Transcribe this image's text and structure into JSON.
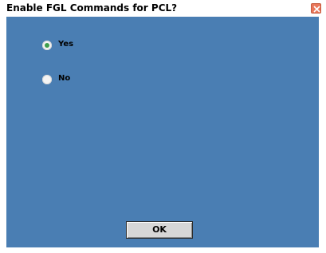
{
  "window": {
    "title": "Enable FGL Commands for PCL?",
    "close_icon": "close-icon",
    "background_color": "#4a7eb3"
  },
  "options": {
    "yes": {
      "label": "Yes",
      "selected": true
    },
    "no": {
      "label": "No",
      "selected": false
    }
  },
  "buttons": {
    "ok_label": "OK"
  }
}
